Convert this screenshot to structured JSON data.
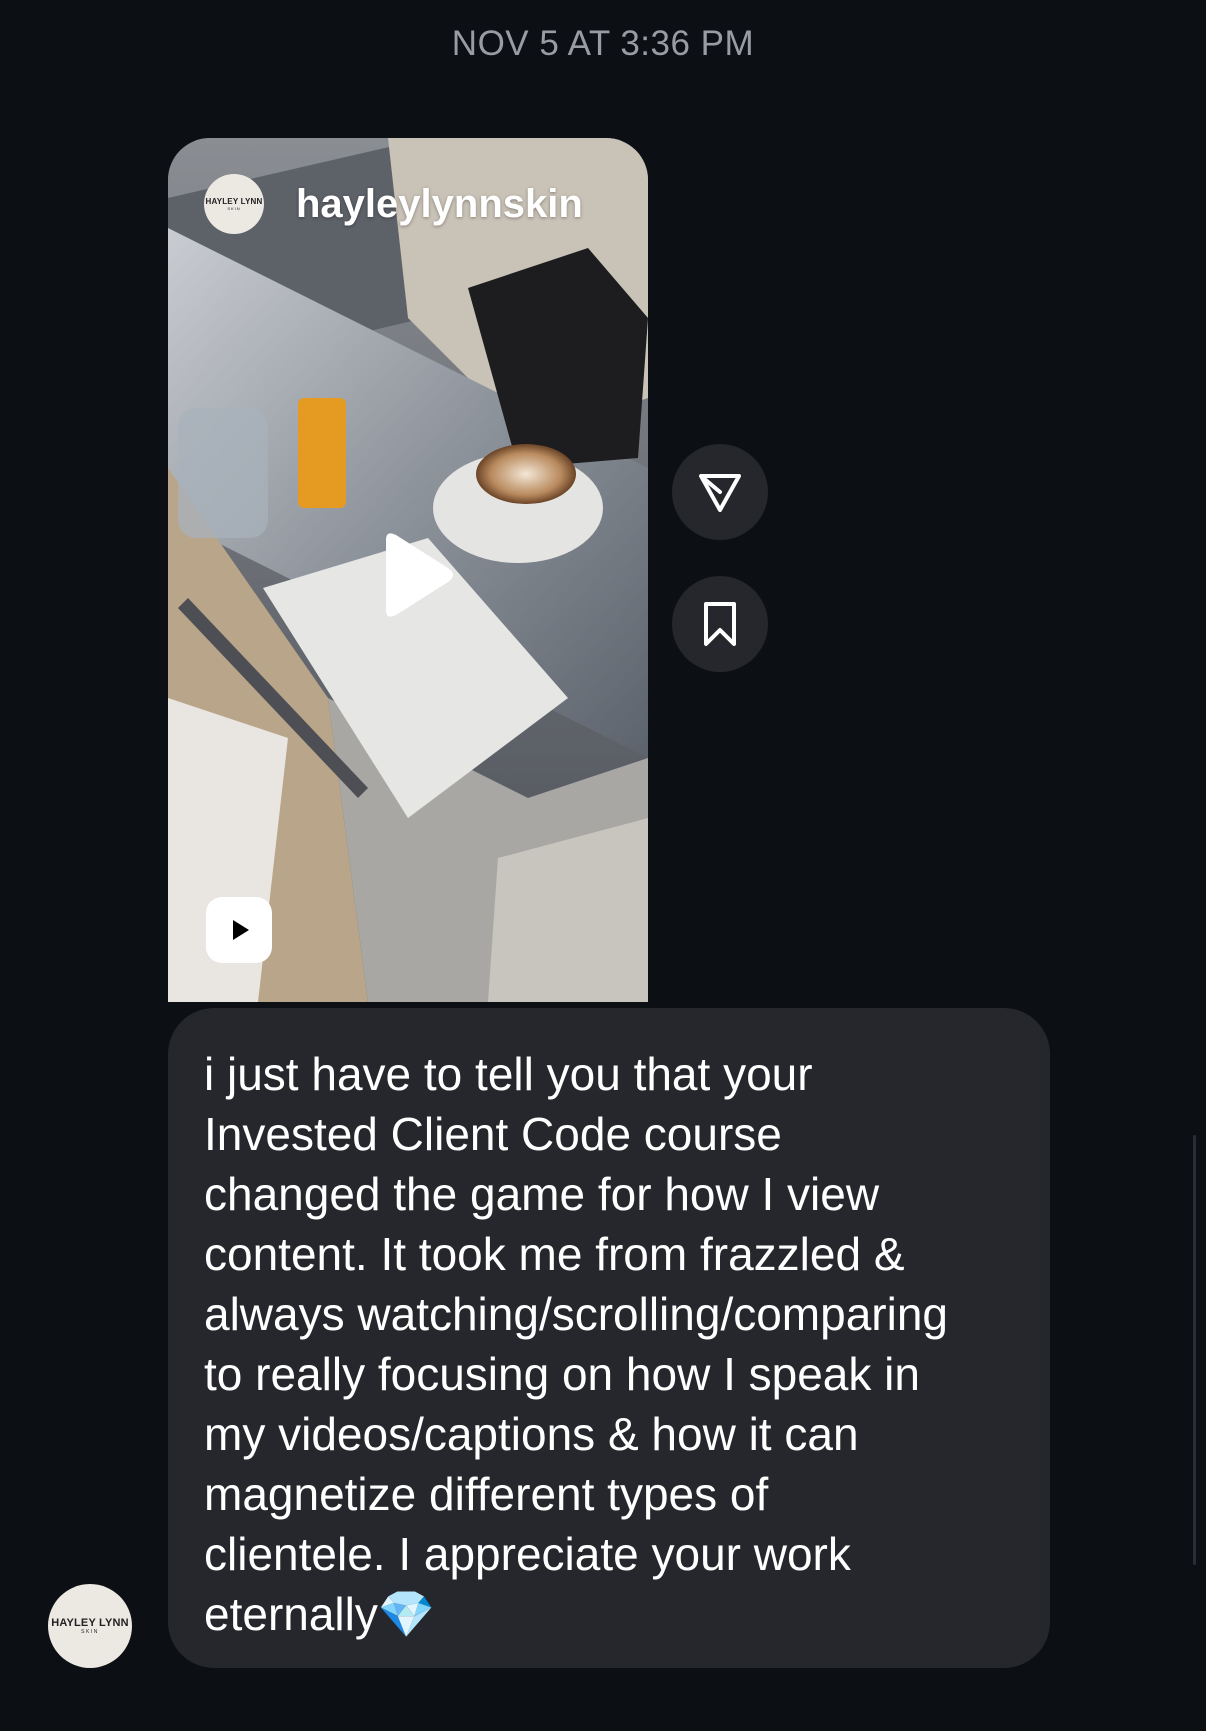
{
  "timestamp": "NOV 5 AT 3:36 PM",
  "shared_reel": {
    "username": "hayleylynnskin",
    "avatar_logo": "HAYLEY LYNN",
    "avatar_logo_sub": "SKIN",
    "media_type": "reel",
    "center_icon": "play-icon",
    "badge_icon": "reels-icon"
  },
  "actions": [
    {
      "name": "share",
      "icon": "send-icon"
    },
    {
      "name": "save",
      "icon": "bookmark-icon"
    }
  ],
  "message": {
    "text": "i just have to tell you that your\nInvested Client Code course\nchanged the game for how I view\ncontent. It took me from frazzled &\nalways watching/scrolling/comparing\nto really focusing on how I speak in\nmy videos/captions & how it can\nmagnetize different types of\nclientele. I appreciate your work\neternally",
    "emoji": "💎"
  },
  "sender_avatar": {
    "logo": "HAYLEY LYNN",
    "logo_sub": "SKIN"
  },
  "colors": {
    "background": "#0c0f14",
    "bubble": "#25272c",
    "timestamp_text": "#9a9ca3",
    "action_button": "#25272c"
  }
}
